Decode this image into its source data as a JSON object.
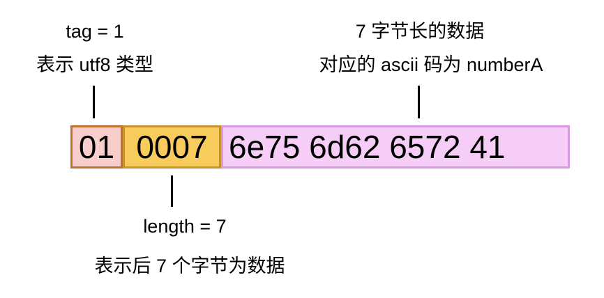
{
  "tag_annotation": {
    "line1": "tag = 1",
    "line2": "表示 utf8 类型"
  },
  "data_annotation": {
    "line1": "7 字节长的数据",
    "line2": "对应的 ascii 码为 numberA"
  },
  "length_annotation": {
    "line1": "length = 7",
    "line2": "表示后 7 个字节为数据"
  },
  "bytes": {
    "tag": "01",
    "length": "0007",
    "data": "6e75 6d62 6572 41"
  },
  "colors": {
    "tag_fill": "#F8CECC",
    "tag_border": "#C0712B",
    "length_fill": "#F7CC5C",
    "length_border": "#C9912A",
    "data_fill": "#F5CDF6",
    "data_border": "#D89BE0"
  }
}
